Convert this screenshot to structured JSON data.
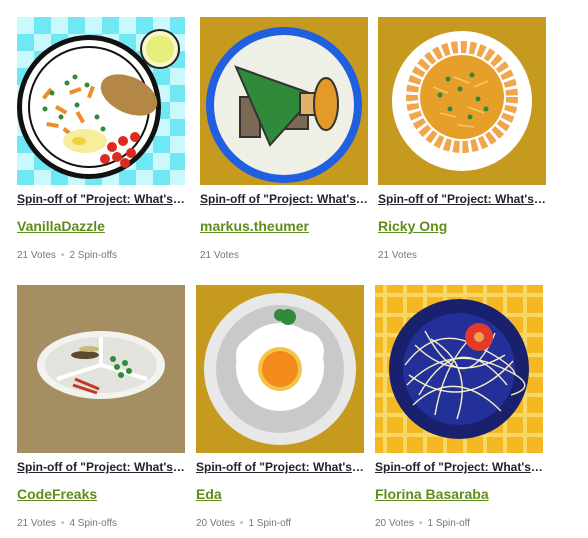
{
  "programs": [
    {
      "title": "Spin-off of \"Project: What's f...",
      "author": "VanillaDazzle",
      "votes": "21 Votes",
      "spinoffs": "2 Spin-offs"
    },
    {
      "title": "Spin-off of \"Project: What's f...",
      "author": "markus.theumer",
      "votes": "21 Votes",
      "spinoffs": ""
    },
    {
      "title": "Spin-off of \"Project: What's f...",
      "author": "Ricky Ong",
      "votes": "21 Votes",
      "spinoffs": ""
    },
    {
      "title": "Spin-off of \"Project: What's f...",
      "author": "CodeFreaks",
      "votes": "21 Votes",
      "spinoffs": "4 Spin-offs"
    },
    {
      "title": "Spin-off of \"Project: What's f...",
      "author": "Eda",
      "votes": "20 Votes",
      "spinoffs": "1 Spin-off"
    },
    {
      "title": "Spin-off of \"Project: What's f...",
      "author": "Florina Basaraba",
      "votes": "20 Votes",
      "spinoffs": "1 Spin-off"
    }
  ],
  "colors": {
    "author_link": "#5f8d1c",
    "title_text": "#21242c",
    "meta_text": "#767676"
  }
}
